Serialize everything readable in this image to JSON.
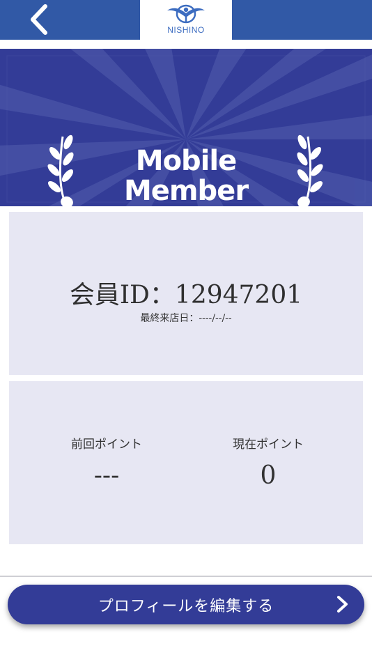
{
  "header": {
    "back_icon": "chevron-left-icon",
    "logo_text": "NISHINO",
    "bar_color": "#3159a6"
  },
  "banner": {
    "title_line1": "Mobile",
    "title_line2": "Member",
    "background_color": "#333c97",
    "decoration_icon": "laurel-icon"
  },
  "member_card": {
    "member_id": "会員ID：12947201",
    "last_visit": "最終来店日：----/--/--"
  },
  "points_card": {
    "previous_label": "前回ポイント",
    "previous_value": "---",
    "current_label": "現在ポイント",
    "current_value": "0"
  },
  "footer": {
    "edit_profile_label": "プロフィールを編集する",
    "edit_profile_icon": "chevron-right-icon",
    "button_color": "#333c97"
  }
}
